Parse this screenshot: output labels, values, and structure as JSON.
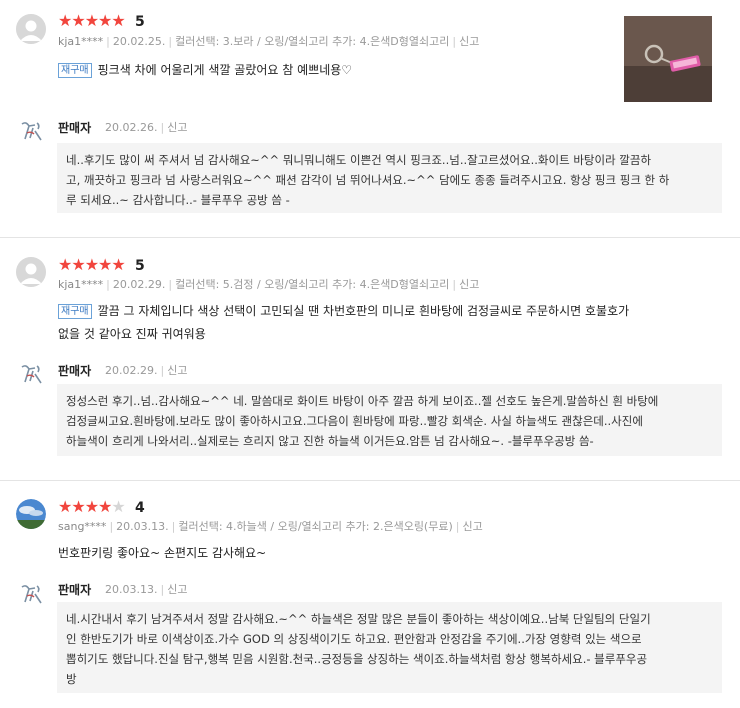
{
  "reviews": [
    {
      "rating": 5,
      "score": "5",
      "user": "kja1****",
      "date": "20.02.25.",
      "option": "컬러선택: 3.보라 / 오링/열쇠고리 추가: 4.은색D형열쇠고리",
      "report": "신고",
      "badge": "재구매",
      "text": [
        "핑크색 차에 어울리게 색깔 골랐어요 참 예쁘네용♡"
      ],
      "seller": {
        "name": "판매자",
        "date": "20.02.26.",
        "report": "신고",
        "lines": [
          "네..후기도 많이 써 주셔서 넘 감사해요~^^ 뭐니뭐니해도 이쁜건 역시 핑크죠..넘..잘고르셨어요..화이트 바탕이라 깔끔하",
          "고, 깨끗하고 핑크라 넘 사랑스러워요~^^ 패션 감각이 넘 뛰어나셔요.~^^ 담에도 종종 들려주시고요. 항상 핑크 핑크 한 하",
          "루 되세요..~ 감사합니다..- 블루푸우 공방 씀 -"
        ]
      }
    },
    {
      "rating": 5,
      "score": "5",
      "user": "kja1****",
      "date": "20.02.29.",
      "option": "컬러선택: 5.검정 / 오링/열쇠고리 추가: 4.은색D형열쇠고리",
      "report": "신고",
      "badge": "재구매",
      "text": [
        "깔끔 그 자체입니다 색상 선택이 고민되실 땐 차번호판의 미니로 흰바탕에 검정글씨로 주문하시면 호불호가",
        "없을 것 같아요 진짜 귀여워용"
      ],
      "seller": {
        "name": "판매자",
        "date": "20.02.29.",
        "report": "신고",
        "lines": [
          "정성스런 후기..넘..감사해요~^^ 네. 말씀대로 화이트 바탕이 아주 깔끔 하게 보이죠..젤 선호도 높은게.말씀하신 흰 바탕에",
          "검정글씨고요.흰바탕에.보라도 많이 좋아하시고요.그다음이 흰바탕에 파랑..빨강 회색순. 사실 하늘색도 괜찮은데..사진에",
          "하늘색이 흐리게 나와서리..실제로는 흐리지 않고 진한 하늘색 이거든요.암튼 넘 감사해요~. -블루푸우공방 씀-"
        ]
      }
    },
    {
      "rating": 4,
      "score": "4",
      "user": "sang****",
      "date": "20.03.13.",
      "option": "컬러선택: 4.하늘색 / 오링/열쇠고리 추가: 2.은색오링(무료)",
      "report": "신고",
      "badge": "",
      "text": [
        "번호판키링 좋아요~ 손편지도 감사해요~"
      ],
      "seller": {
        "name": "판매자",
        "date": "20.03.13.",
        "report": "신고",
        "lines": [
          "네.시간내서 후기 남겨주셔서 정말 감사해요.~^^ 하늘색은 정말 많은 분들이 좋아하는 색상이예요..남북 단일팀의 단일기",
          "인 한반도기가 바로 이색상이죠.가수 GOD 의 상징색이기도 하고요. 편안함과 안정감을 주기에..가장 영향력 있는 색으로",
          "뽑히기도 했답니다.진실 탐구,행복 믿음 시원함.천국..긍정등을 상징하는 색이죠.하늘색처럼 항상 행복하세요.- 블루푸우공",
          "방"
        ]
      }
    }
  ],
  "colors": {
    "star": "#f1453d",
    "star_off": "#d6d6d6",
    "badge": "#3c7ac2",
    "reply_bg": "#f4f4f4"
  },
  "icons": {
    "default_avatar": "user-silhouette-icon",
    "seller_avatar": "bear-logo-icon",
    "sky_avatar": "sky-photo-icon",
    "star": "star-icon"
  }
}
